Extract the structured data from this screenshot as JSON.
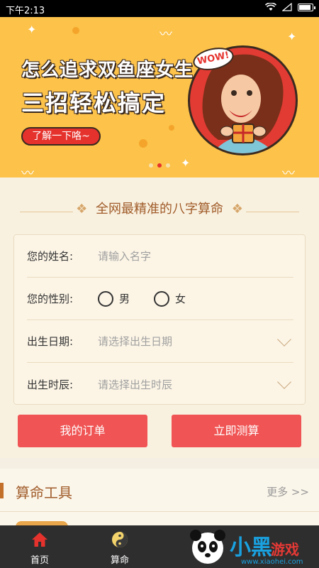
{
  "status_bar": {
    "time": "下午2:13"
  },
  "banner": {
    "line1": "怎么追求双鱼座女生",
    "line2": "三招轻松搞定",
    "cta": "了解一下咯~",
    "bubble_text": "WOW!",
    "active_dot": 1,
    "dot_count": 3
  },
  "form": {
    "title": "全网最精准的八字算命",
    "title_deco_left": "❖",
    "title_deco_right": "❖",
    "name_label": "您的姓名:",
    "name_placeholder": "请输入名字",
    "gender_label": "您的性别:",
    "gender_male": "男",
    "gender_female": "女",
    "birth_date_label": "出生日期:",
    "birth_date_placeholder": "请选择出生日期",
    "birth_time_label": "出生时辰:",
    "birth_time_placeholder": "请选择出生时辰"
  },
  "buttons": {
    "my_orders": "我的订单",
    "calculate_now": "立即测算"
  },
  "tools": {
    "title": "算命工具",
    "more": "更多 >>"
  },
  "bottom_nav": {
    "home": "首页",
    "fortune": "算命"
  },
  "watermark": {
    "brand_part1": "小黑",
    "brand_part2": "游戏",
    "url": "www.xiaohei.com"
  },
  "colors": {
    "banner_bg": "#fcc24a",
    "button_red": "#f05454",
    "accent_brown": "#a05c2a",
    "nav_bg": "#2e2e2e",
    "home_icon_red": "#e5322d"
  }
}
